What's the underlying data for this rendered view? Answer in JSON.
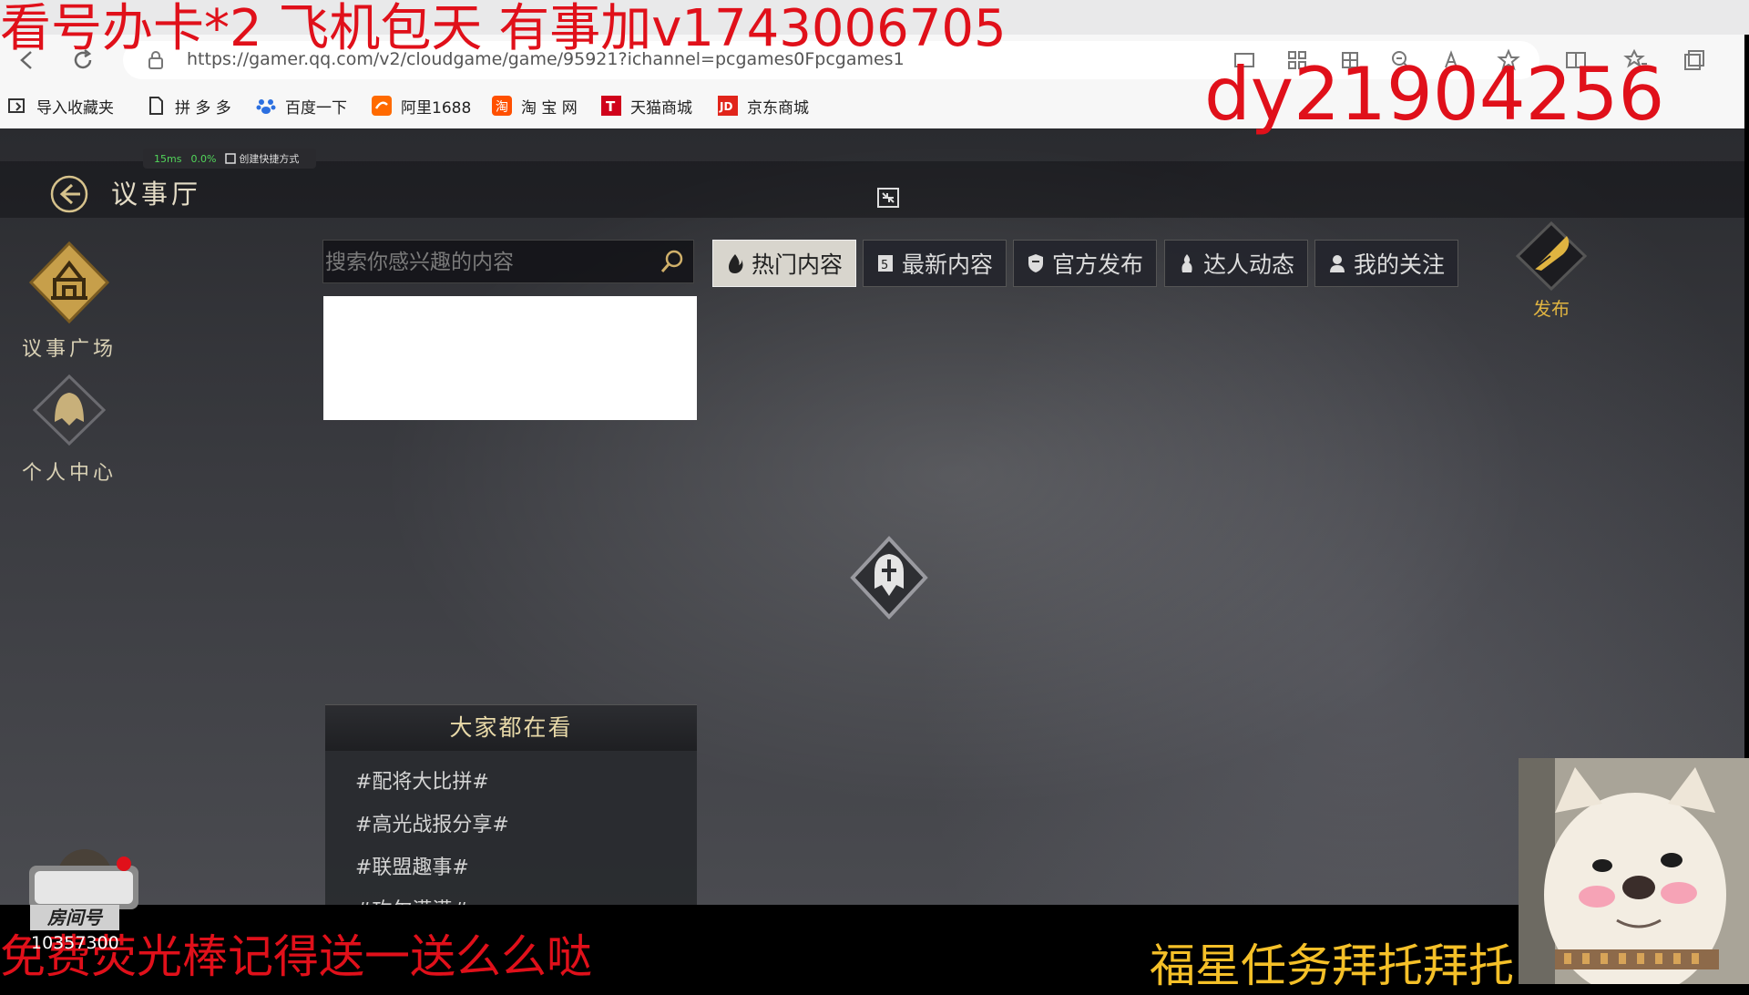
{
  "browser": {
    "url": "https://gamer.qq.com/v2/cloudgame/game/95921?ichannel=pcgames0Fpcgames1",
    "bookmarks": [
      "导入收藏夹",
      "拼 多 多",
      "百度一下",
      "阿里1688",
      "淘 宝 网",
      "天猫商城",
      "京东商城"
    ]
  },
  "overlay": {
    "top_left_text": "看号办卡*2 飞机包天   有事加v1743006705",
    "top_right_text": "dy21904256",
    "bottom_left_text": "免费荧光棒记得送一送么么哒",
    "bottom_right_text": "福星任务拜托拜托",
    "room_label": "房间号",
    "room_number": "10357300"
  },
  "game": {
    "stats": {
      "latency": "15ms",
      "loss": "0.0%",
      "shortcut_label": "创建快捷方式"
    },
    "title": "议事厅",
    "sidebar": [
      {
        "label": "议事广场",
        "icon": "hall-icon"
      },
      {
        "label": "个人中心",
        "icon": "helmet-icon"
      }
    ],
    "search": {
      "placeholder": "搜索你感兴趣的内容",
      "value": ""
    },
    "tabs": [
      {
        "label": "热门内容",
        "icon": "fire-icon",
        "active": true
      },
      {
        "label": "最新内容",
        "icon": "new-icon",
        "active": false
      },
      {
        "label": "官方发布",
        "icon": "shield-icon",
        "active": false
      },
      {
        "label": "达人动态",
        "icon": "flame-person-icon",
        "active": false
      },
      {
        "label": "我的关注",
        "icon": "follow-icon",
        "active": false
      }
    ],
    "publish_label": "发布",
    "trending": {
      "title": "大家都在看",
      "items": [
        "#配将大比拼#",
        "#高光战报分享#",
        "#联盟趣事#",
        "#攻尔满满#"
      ]
    }
  },
  "colors": {
    "accent_gold": "#e0b441",
    "overlay_red": "#e0101a",
    "overlay_yellow": "#f5c028"
  }
}
